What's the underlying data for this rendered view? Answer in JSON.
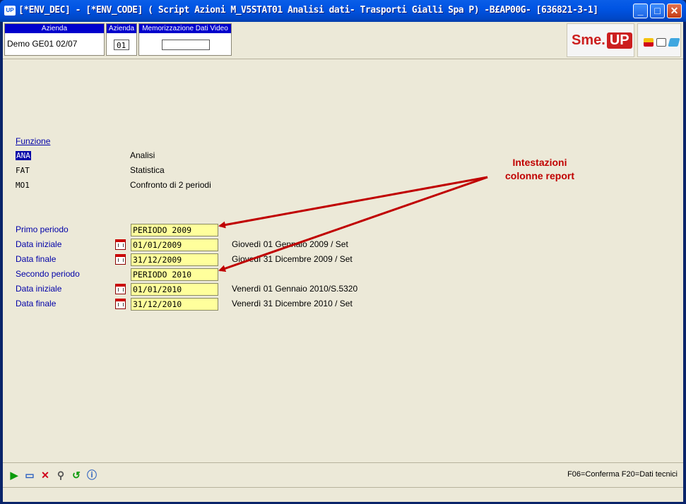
{
  "window": {
    "icon_text": "UP",
    "title": "[*ENV_DEC] - [*ENV_CODE] ( Script Azioni M_V5STAT01 Analisi dati- Trasporti Gialli Spa P) -B£AP00G- [636821-3-1]"
  },
  "header": {
    "azienda_header": "Azienda",
    "azienda_value": "Demo GE01 02/07",
    "azienda_code_header": "Azienda",
    "azienda_code_value": "01",
    "memo_header": "Memorizzazione Dati Video",
    "memo_value": ""
  },
  "logo": {
    "text_sme": "Sme.",
    "text_up": "UP"
  },
  "funzione": {
    "label": "Funzione",
    "rows": [
      {
        "code": "ANA",
        "desc": "Analisi"
      },
      {
        "code": "FAT",
        "desc": "Statistica"
      },
      {
        "code": "MO1",
        "desc": "Confronto di 2 periodi"
      }
    ]
  },
  "form": {
    "primo_periodo_label": "Primo periodo",
    "primo_periodo_value": "PERIODO 2009",
    "data_iniziale_1_label": "Data iniziale",
    "data_iniziale_1_value": "01/01/2009",
    "data_iniziale_1_desc": "Giovedì 01 Gennaio 2009 / Set",
    "data_finale_1_label": "Data finale",
    "data_finale_1_value": "31/12/2009",
    "data_finale_1_desc": "Giovedì 31 Dicembre 2009 / Set",
    "secondo_periodo_label": "Secondo periodo",
    "secondo_periodo_value": "PERIODO 2010",
    "data_iniziale_2_label": "Data iniziale",
    "data_iniziale_2_value": "01/01/2010",
    "data_iniziale_2_desc": "Venerdì 01 Gennaio 2010/S.5320",
    "data_finale_2_label": "Data finale",
    "data_finale_2_value": "31/12/2010",
    "data_finale_2_desc": "Venerdì 31 Dicembre 2010 / Set"
  },
  "annotation": {
    "line1": "Intestazioni",
    "line2": "colonne report",
    "color": "#c00000"
  },
  "footer": {
    "fkeys": "F06=Conferma   F20=Dati tecnici",
    "tools": [
      "play-icon",
      "eraser-icon",
      "cancel-icon",
      "magnifier-icon",
      "refresh-icon",
      "info-icon"
    ]
  },
  "colors": {
    "field_bg": "#ffff9c",
    "label_blue": "#0000a8",
    "header_blue": "#0000cc"
  }
}
